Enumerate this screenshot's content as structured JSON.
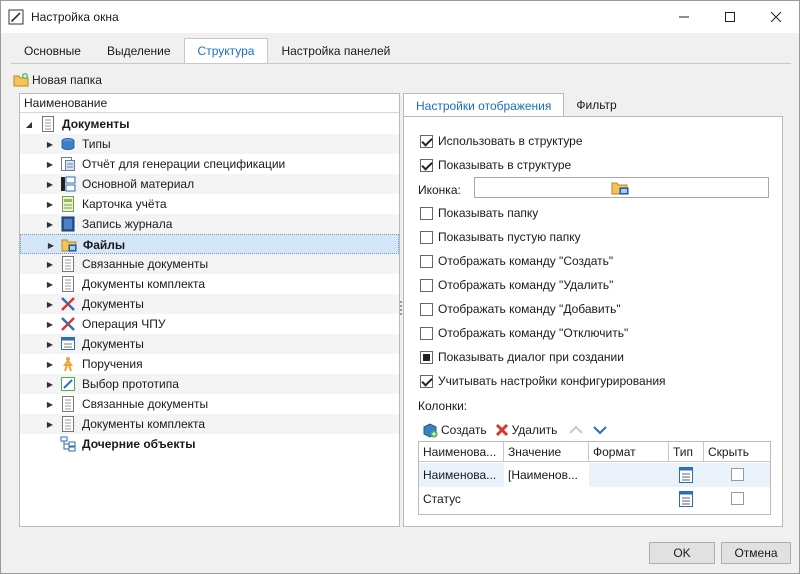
{
  "window": {
    "title": "Настройка окна"
  },
  "tabs": [
    "Основные",
    "Выделение",
    "Структура",
    "Настройка панелей"
  ],
  "toolbar": {
    "new_folder": "Новая папка"
  },
  "tree": {
    "header": "Наименование",
    "items": [
      {
        "label": "Документы",
        "bold": true,
        "icon": "document-icon"
      },
      {
        "label": "Типы",
        "icon": "types-icon"
      },
      {
        "label": "Отчёт для генерации спецификации",
        "icon": "report-icon"
      },
      {
        "label": "Основной материал",
        "icon": "material-icon"
      },
      {
        "label": "Карточка учёта",
        "icon": "card-icon"
      },
      {
        "label": "Запись журнала",
        "icon": "journal-icon"
      },
      {
        "label": "Файлы",
        "bold": true,
        "icon": "folder-icon"
      },
      {
        "label": "Связанные документы",
        "icon": "document-icon"
      },
      {
        "label": "Документы комплекта",
        "icon": "document-icon"
      },
      {
        "label": "Документы",
        "icon": "tools-icon"
      },
      {
        "label": "Операция ЧПУ",
        "icon": "tools-icon"
      },
      {
        "label": "Документы",
        "icon": "monitor-doc-icon"
      },
      {
        "label": "Поручения",
        "icon": "person-icon"
      },
      {
        "label": "Выбор прототипа",
        "icon": "edit-icon"
      },
      {
        "label": "Связанные документы",
        "icon": "document-icon"
      },
      {
        "label": "Документы комплекта",
        "icon": "document-icon"
      },
      {
        "label": "Дочерние объекты",
        "bold": true,
        "icon": "hierarchy-icon"
      }
    ]
  },
  "right_tabs": [
    "Настройки отображения",
    "Фильтр"
  ],
  "settings": {
    "use_in_structure": "Использовать в структуре",
    "show_in_structure": "Показывать в структуре",
    "icon_label": "Иконка:",
    "show_folder": "Показывать папку",
    "show_empty_folder": "Показывать пустую папку",
    "cmd_create": "Отображать команду \"Создать\"",
    "cmd_delete": "Отображать команду \"Удалить\"",
    "cmd_add": "Отображать команду \"Добавить\"",
    "cmd_disable": "Отображать команду \"Отключить\"",
    "show_dialog": "Показывать диалог при создании",
    "use_config": "Учитывать настройки конфигурирования",
    "columns_label": "Колонки:",
    "create_btn": "Создать",
    "delete_btn": "Удалить"
  },
  "grid": {
    "headers": [
      "Наименова...",
      "Значение",
      "Формат",
      "Тип",
      "Скрыть"
    ],
    "rows": [
      {
        "name": "Наименова...",
        "value": "[Наименов...",
        "format": ""
      },
      {
        "name": "Статус",
        "value": "",
        "format": ""
      }
    ]
  },
  "footer": {
    "ok": "OK",
    "cancel": "Отмена"
  }
}
